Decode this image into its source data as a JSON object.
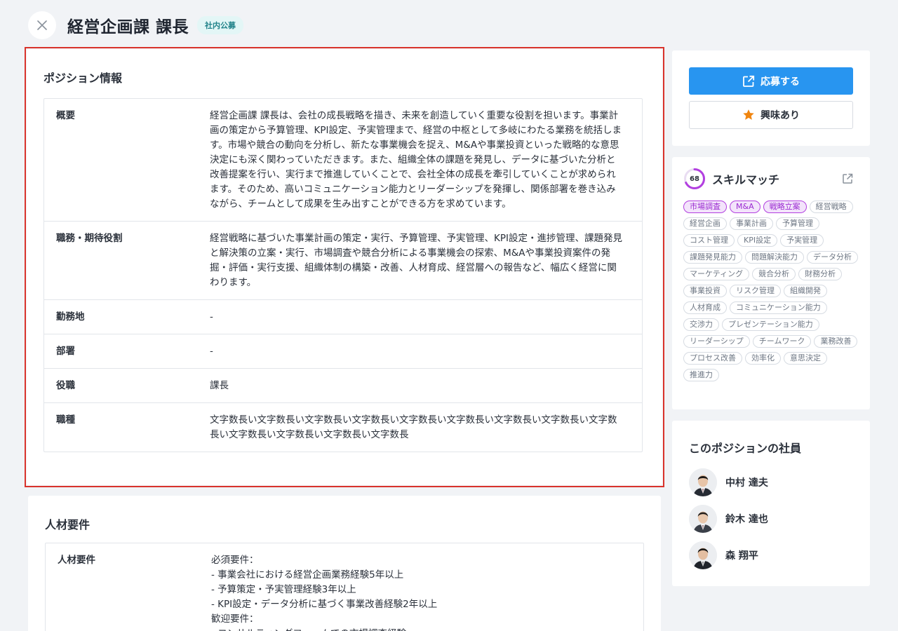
{
  "header": {
    "title": "経営企画課 課長",
    "badge": "社内公募"
  },
  "position": {
    "section_title": "ポジション情報",
    "rows": [
      {
        "label": "概要",
        "value": "経営企画課 課長は、会社の成長戦略を描き、未来を創造していく重要な役割を担います。事業計画の策定から予算管理、KPI設定、予実管理まで、経営の中枢として多岐にわたる業務を統括します。市場や競合の動向を分析し、新たな事業機会を捉え、M&Aや事業投資といった戦略的な意思決定にも深く関わっていただきます。また、組織全体の課題を発見し、データに基づいた分析と改善提案を行い、実行まで推進していくことで、会社全体の成長を牽引していくことが求められます。そのため、高いコミュニケーション能力とリーダーシップを発揮し、関係部署を巻き込みながら、チームとして成果を生み出すことができる方を求めています。"
      },
      {
        "label": "職務・期待役割",
        "value": "経営戦略に基づいた事業計画の策定・実行、予算管理、予実管理、KPI設定・進捗管理、課題発見と解決策の立案・実行、市場調査や競合分析による事業機会の探索、M&Aや事業投資案件の発掘・評価・実行支援、組織体制の構築・改善、人材育成、経営層への報告など、幅広く経営に関わります。"
      },
      {
        "label": "勤務地",
        "value": "-"
      },
      {
        "label": "部署",
        "value": "-"
      },
      {
        "label": "役職",
        "value": "課長"
      },
      {
        "label": "職種",
        "value": "文字数長い文字数長い文字数長い文字数長い文字数長い文字数長い文字数長い文字数長い文字数長い文字数長い文字数長い文字数長い文字数長"
      }
    ]
  },
  "talent": {
    "section_title": "人材要件",
    "rows": [
      {
        "label": "人材要件",
        "value": "必須要件：\n- 事業会社における経営企画業務経験5年以上\n- 予算策定・予実管理経験3年以上\n- KPI設定・データ分析に基づく事業改善経験2年以上\n歓迎要件：\n- コンサルティングファームでの市場調査経験"
      }
    ]
  },
  "actions": {
    "apply_label": "応募する",
    "interest_label": "興味あり"
  },
  "skill_match": {
    "title": "スキルマッチ",
    "score": "68",
    "score_fraction": 0.68,
    "colors": {
      "match": "#b23fe0",
      "accent": "#2895f0"
    },
    "tags": [
      {
        "label": "市場調査",
        "matched": true
      },
      {
        "label": "M&A",
        "matched": true
      },
      {
        "label": "戦略立案",
        "matched": true
      },
      {
        "label": "経営戦略",
        "matched": false
      },
      {
        "label": "経営企画",
        "matched": false
      },
      {
        "label": "事業計画",
        "matched": false
      },
      {
        "label": "予算管理",
        "matched": false
      },
      {
        "label": "コスト管理",
        "matched": false
      },
      {
        "label": "KPI設定",
        "matched": false
      },
      {
        "label": "予実管理",
        "matched": false
      },
      {
        "label": "課題発見能力",
        "matched": false
      },
      {
        "label": "問題解決能力",
        "matched": false
      },
      {
        "label": "データ分析",
        "matched": false
      },
      {
        "label": "マーケティング",
        "matched": false
      },
      {
        "label": "競合分析",
        "matched": false
      },
      {
        "label": "財務分析",
        "matched": false
      },
      {
        "label": "事業投資",
        "matched": false
      },
      {
        "label": "リスク管理",
        "matched": false
      },
      {
        "label": "組織開発",
        "matched": false
      },
      {
        "label": "人材育成",
        "matched": false
      },
      {
        "label": "コミュニケーション能力",
        "matched": false
      },
      {
        "label": "交渉力",
        "matched": false
      },
      {
        "label": "プレゼンテーション能力",
        "matched": false
      },
      {
        "label": "リーダーシップ",
        "matched": false
      },
      {
        "label": "チームワーク",
        "matched": false
      },
      {
        "label": "業務改善",
        "matched": false
      },
      {
        "label": "プロセス改善",
        "matched": false
      },
      {
        "label": "効率化",
        "matched": false
      },
      {
        "label": "意思決定",
        "matched": false
      },
      {
        "label": "推進力",
        "matched": false
      }
    ]
  },
  "members": {
    "title": "このポジションの社員",
    "people": [
      {
        "name": "中村 達夫"
      },
      {
        "name": "鈴木 達也"
      },
      {
        "name": "森 翔平"
      }
    ]
  }
}
